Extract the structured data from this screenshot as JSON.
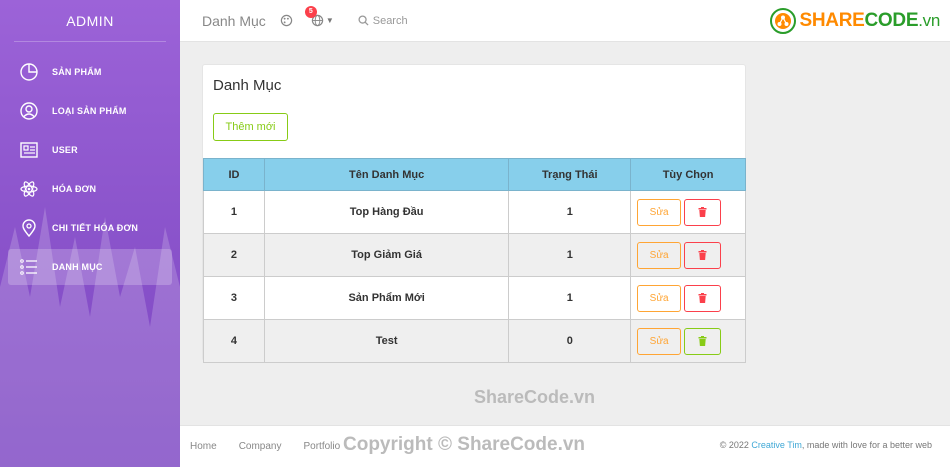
{
  "sidebar": {
    "brand": "ADMIN",
    "items": [
      {
        "label": "SẢN PHẨM",
        "icon": "pie-chart-icon",
        "active": false
      },
      {
        "label": "LOẠI SẢN PHẨM",
        "icon": "user-circle-icon",
        "active": false
      },
      {
        "label": "USER",
        "icon": "id-card-icon",
        "active": false
      },
      {
        "label": "HÓA ĐƠN",
        "icon": "atom-icon",
        "active": false
      },
      {
        "label": "CHI TIẾT HÓA ĐƠN",
        "icon": "map-pin-icon",
        "active": false
      },
      {
        "label": "DANH MỤC",
        "icon": "list-icon",
        "active": true
      }
    ]
  },
  "navbar": {
    "title": "Danh Mục",
    "notification_count": "5",
    "search_label": "Search",
    "logo": {
      "share": "SHARE",
      "code": "CODE",
      "vn": ".vn"
    }
  },
  "card": {
    "title": "Danh Mục",
    "add_label": "Thêm mới"
  },
  "table": {
    "headers": {
      "id": "ID",
      "name": "Tên Danh Mục",
      "status": "Trạng Thái",
      "options": "Tùy Chọn"
    },
    "edit_label": "Sửa",
    "rows": [
      {
        "id": "1",
        "name": "Top Hàng Đầu",
        "status": "1"
      },
      {
        "id": "2",
        "name": "Top Giảm Giá",
        "status": "1"
      },
      {
        "id": "3",
        "name": "Sản Phẩm Mới",
        "status": "1"
      },
      {
        "id": "4",
        "name": "Test",
        "status": "0"
      }
    ]
  },
  "watermark": "ShareCode.vn",
  "footer": {
    "links": [
      "Home",
      "Company",
      "Portfolio"
    ],
    "copyright_watermark": "Copyright © ShareCode.vn",
    "right_prefix": "© 2022 ",
    "right_link": "Creative Tim",
    "right_suffix": ", made with love for a better web"
  },
  "colors": {
    "sidebar_gradient_top": "#9c63d8",
    "sidebar_gradient_bottom": "#7b45c2",
    "table_header": "#87cfeb",
    "edit_border": "#ffa534",
    "delete_border": "#fb404b",
    "success": "#87cb16",
    "link": "#3fa8d6"
  }
}
